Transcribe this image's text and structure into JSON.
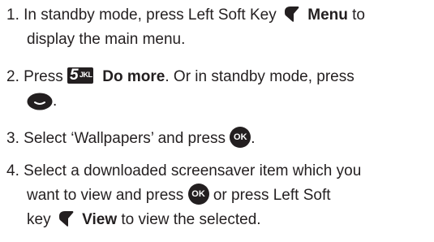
{
  "steps": [
    {
      "number": "1.",
      "line1": "In standby mode, press Left Soft Key",
      "menu_label": "Menu",
      "line1_end": " to",
      "line2": "display the main menu."
    },
    {
      "number": "2.",
      "press": "Press",
      "key_number": "5",
      "key_letters": "JKL",
      "do_more_label": "Do more",
      "line1_end": ". Or in standby mode, press",
      "line2_end": "."
    },
    {
      "number": "3.",
      "text": "Select ‘Wallpapers’ and press",
      "ok_label": "OK",
      "end": "."
    },
    {
      "number": "4.",
      "line1": "Select a downloaded screensaver item which you",
      "line2": "want to view and press",
      "ok_label": "OK",
      "line2_end": "or press Left Soft",
      "line3": "key",
      "view_label": "View",
      "line3_end": "to view the selected."
    }
  ]
}
